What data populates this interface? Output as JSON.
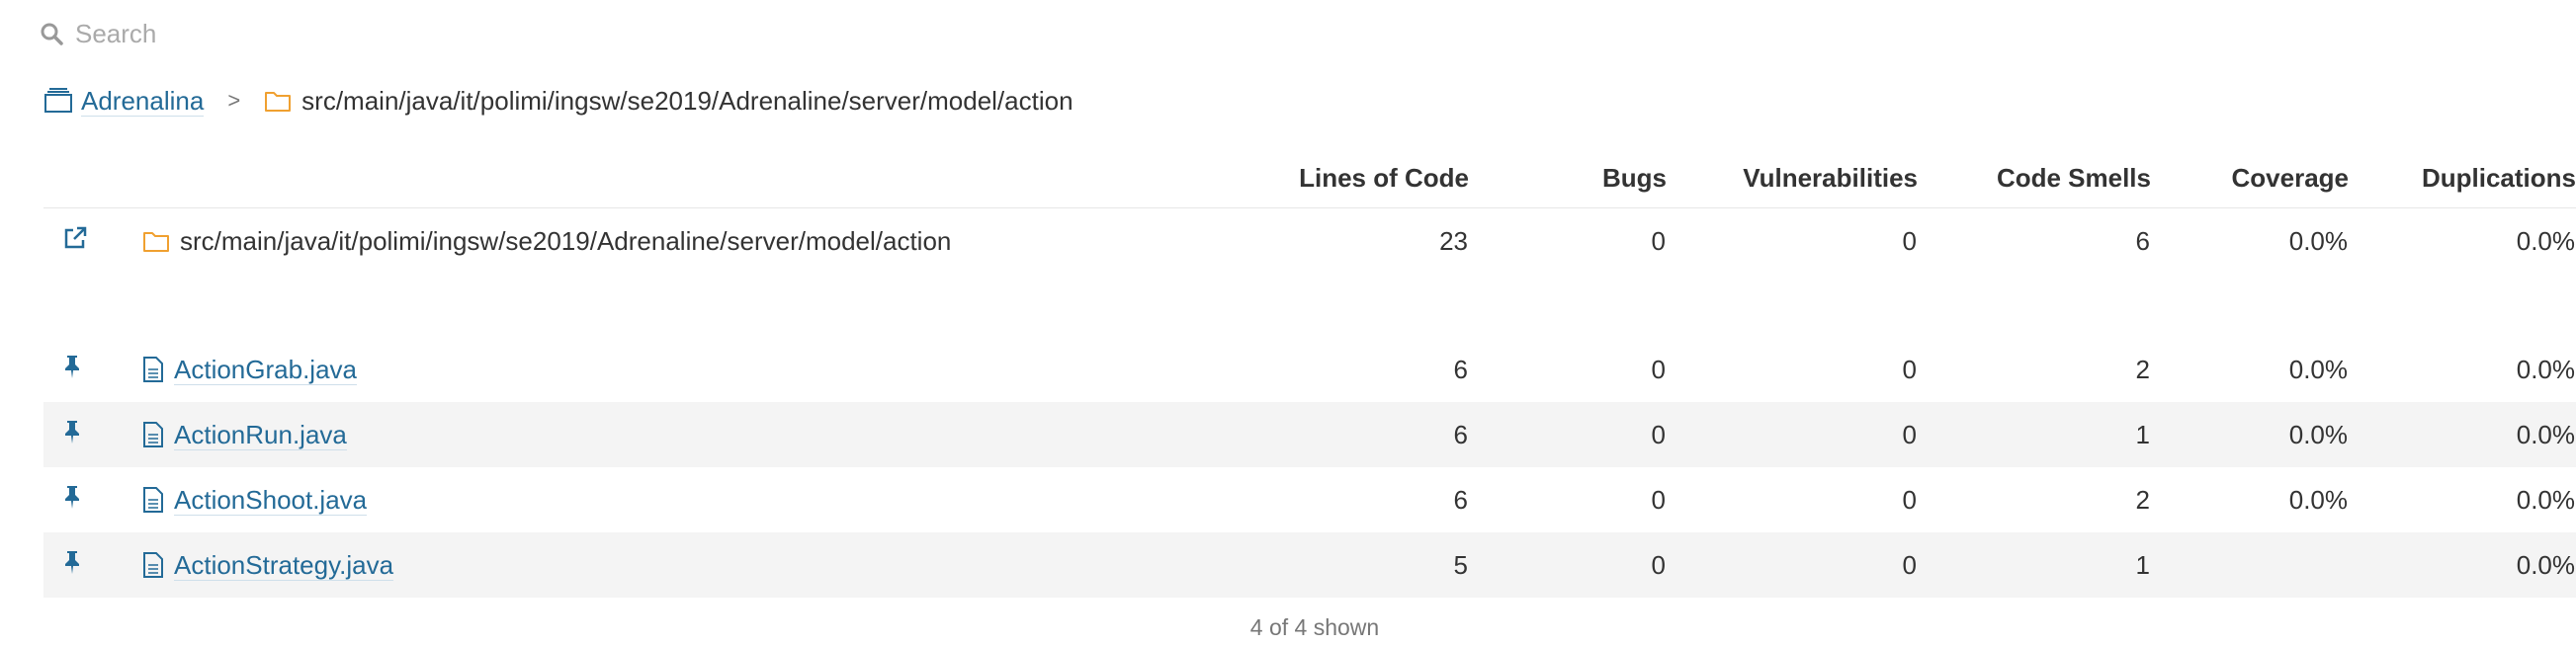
{
  "search": {
    "placeholder": "Search",
    "value": ""
  },
  "breadcrumb": {
    "project": "Adrenalina",
    "separator": ">",
    "path": "src/main/java/it/polimi/ingsw/se2019/Adrenaline/server/model/action"
  },
  "table": {
    "columns": [
      "Lines of Code",
      "Bugs",
      "Vulnerabilities",
      "Code Smells",
      "Coverage",
      "Duplications"
    ],
    "directory": {
      "name": "src/main/java/it/polimi/ingsw/se2019/Adrenaline/server/model/action",
      "loc": "23",
      "bugs": "0",
      "vulnerabilities": "0",
      "code_smells": "6",
      "coverage": "0.0%",
      "duplications": "0.0%"
    },
    "files": [
      {
        "name": "ActionGrab.java",
        "loc": "6",
        "bugs": "0",
        "vulnerabilities": "0",
        "code_smells": "2",
        "coverage": "0.0%",
        "duplications": "0.0%"
      },
      {
        "name": "ActionRun.java",
        "loc": "6",
        "bugs": "0",
        "vulnerabilities": "0",
        "code_smells": "1",
        "coverage": "0.0%",
        "duplications": "0.0%"
      },
      {
        "name": "ActionShoot.java",
        "loc": "6",
        "bugs": "0",
        "vulnerabilities": "0",
        "code_smells": "2",
        "coverage": "0.0%",
        "duplications": "0.0%"
      },
      {
        "name": "ActionStrategy.java",
        "loc": "5",
        "bugs": "0",
        "vulnerabilities": "0",
        "code_smells": "1",
        "coverage": "",
        "duplications": "0.0%"
      }
    ]
  },
  "footer": {
    "shown": "4 of 4 shown"
  },
  "colors": {
    "link": "#236a97",
    "folder": "#f0a030",
    "alt_row": "#f4f4f4"
  }
}
